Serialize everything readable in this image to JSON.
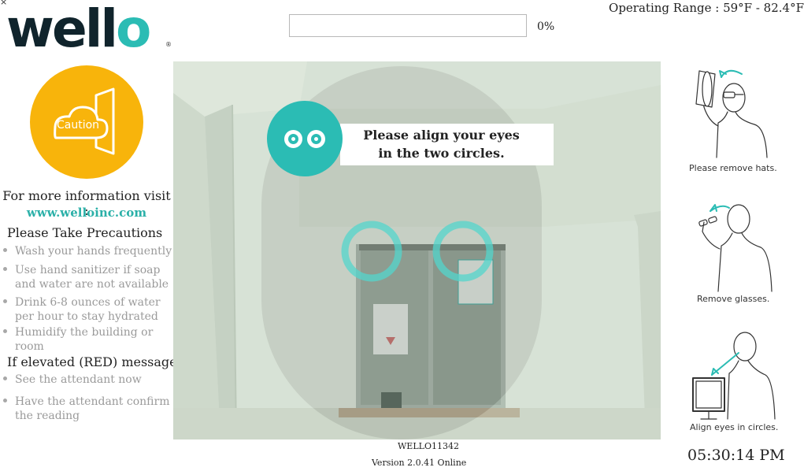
{
  "app": {
    "close_glyph": "×",
    "logo_main": "well",
    "logo_o": "o",
    "logo_reg": "®"
  },
  "header": {
    "progress_percent": 0,
    "progress_label": "0%",
    "operating_range": "Operating Range : 59°F - 82.4°F"
  },
  "left_panel": {
    "caution_label": "Caution",
    "info_visit": "For more information visit :",
    "info_url": "www.welloinc.com",
    "precautions_heading": "Please Take Precautions",
    "precautions": [
      "Wash your hands frequently",
      "Use hand sanitizer if soap and water are not available",
      "Drink 6-8 ounces of water per hour to stay hydrated",
      "Humidify the building or room"
    ],
    "elevated_heading": "If elevated (RED) message",
    "elevated_steps": [
      "See the attendant now",
      "Have the attendant confirm the reading"
    ]
  },
  "camera": {
    "prompt_line1": "Please align your eyes",
    "prompt_line2": "in the two circles."
  },
  "instructions": {
    "remove_hats": "Please remove hats.",
    "remove_glasses": "Remove glasses.",
    "align_eyes": "Align eyes in circles."
  },
  "footer": {
    "device_id": "WELLO11342",
    "version": "Version 2.0.41 Online",
    "clock": "05:30:14 PM"
  },
  "colors": {
    "accent": "#2bbcb4",
    "caution": "#f8b40b",
    "logo_dark": "#10242c"
  },
  "icons": [
    "close-icon",
    "caution-door-cloud-icon",
    "eyes-icon",
    "remove-hat-illustration",
    "remove-glasses-illustration",
    "align-eyes-illustration"
  ]
}
